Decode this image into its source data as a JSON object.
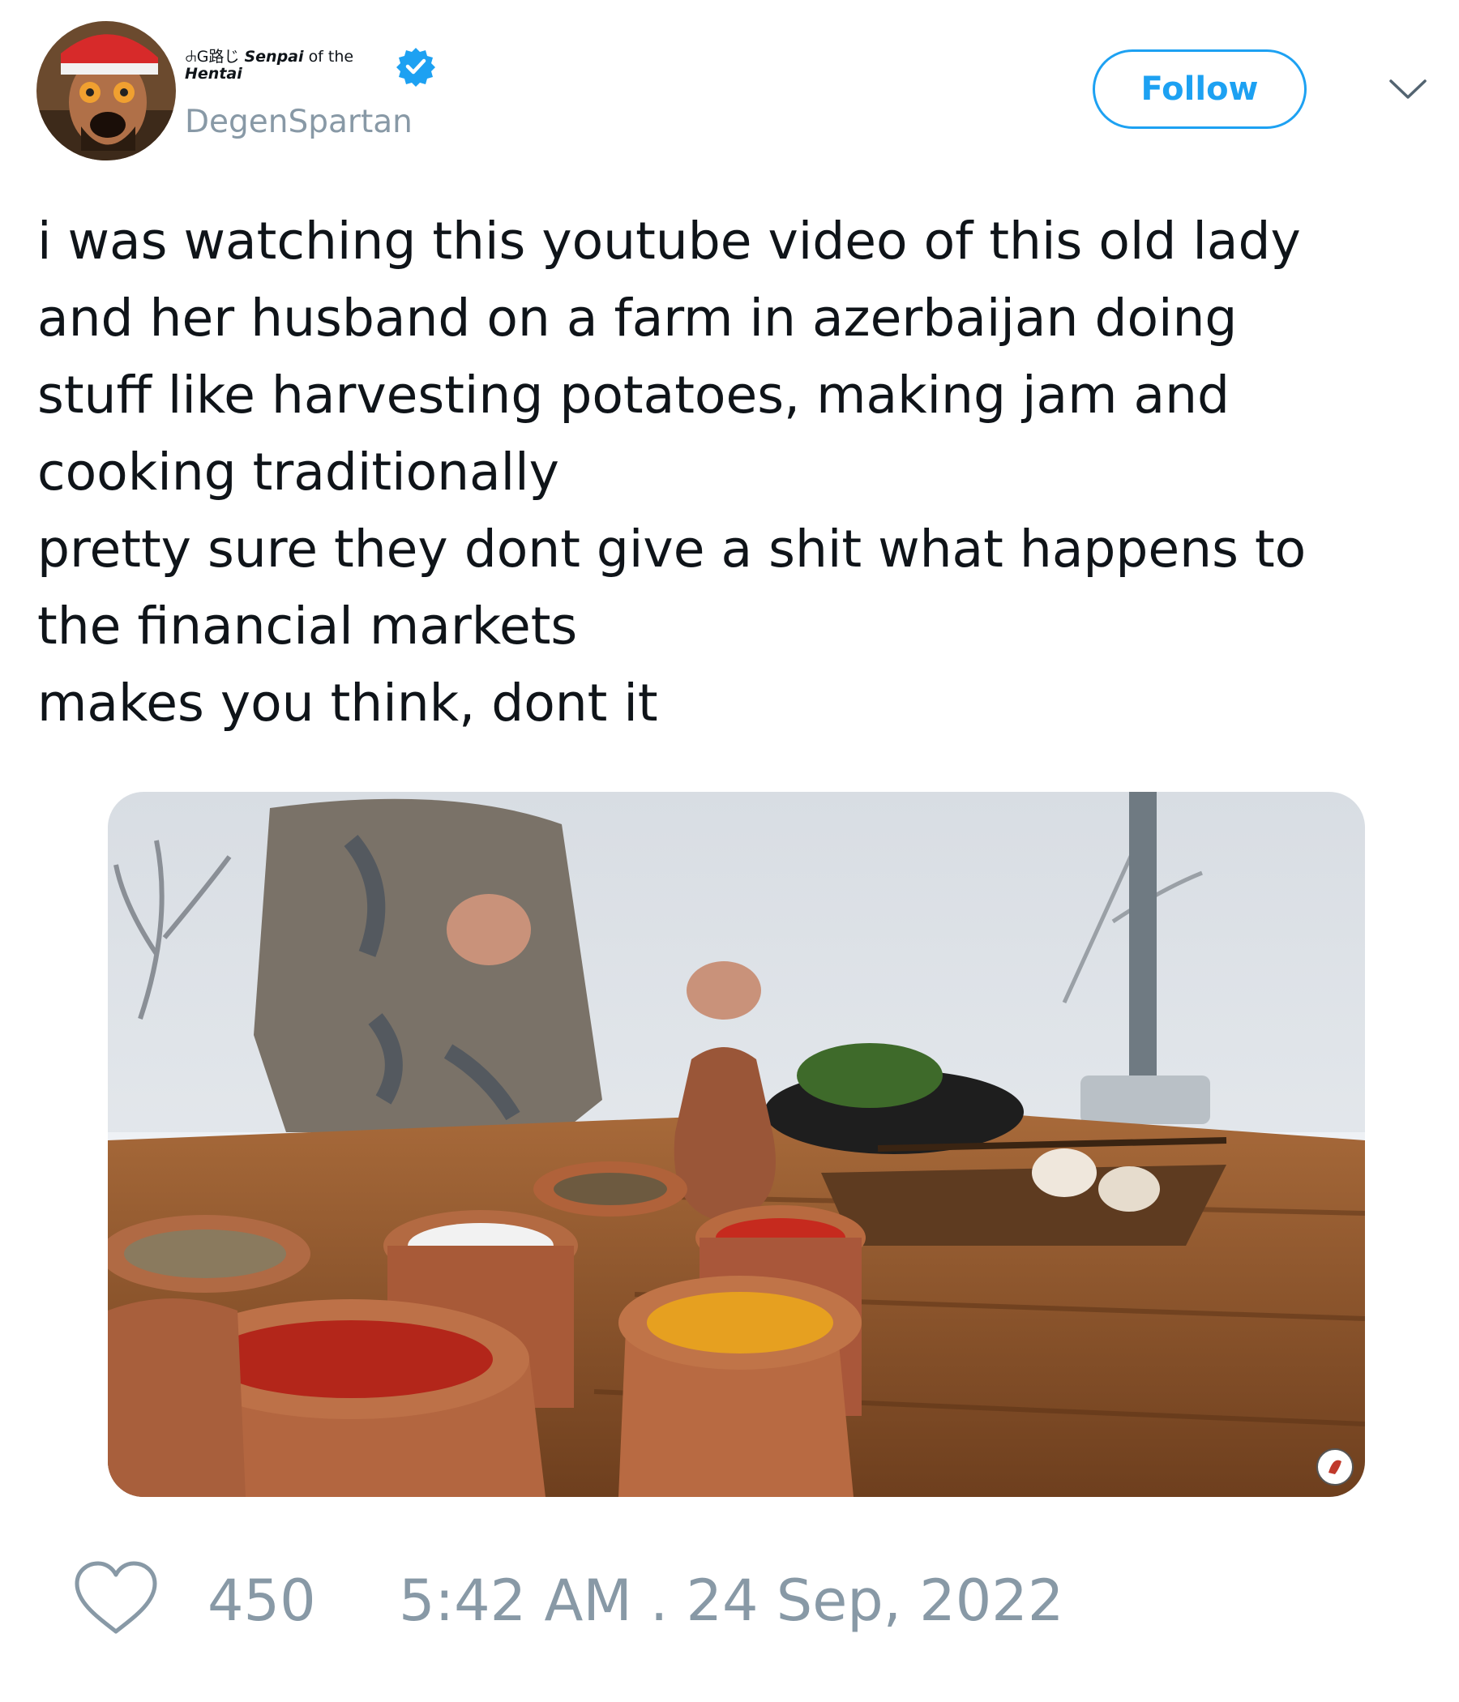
{
  "user": {
    "display_name_prefix": "ꕈG路じ",
    "display_name_bold": "Senpai",
    "display_name_suffix": "of the",
    "display_name_line2": "Hentai",
    "handle": "DegenSpartan",
    "verified": true,
    "avatar_icon": "avatar-image"
  },
  "header": {
    "follow_label": "Follow",
    "menu_icon": "chevron-down-icon"
  },
  "tweet": {
    "lines": [
      "i was watching this youtube video of this old lady",
      "and her husband on a farm in azerbaijan doing",
      "stuff like harvesting potatoes, making jam and",
      "cooking traditionally",
      "pretty sure they dont give a shit what happens to",
      "the financial markets",
      "makes you think, dont it"
    ]
  },
  "media": {
    "icon": "photo-spices-in-clay-pots"
  },
  "footer": {
    "like_icon": "heart-icon",
    "like_count": "450",
    "timestamp": "5:42 AM . 24 Sep, 2022"
  },
  "colors": {
    "accent": "#1da1f2",
    "muted": "#8899a6",
    "text": "#0f1419"
  }
}
